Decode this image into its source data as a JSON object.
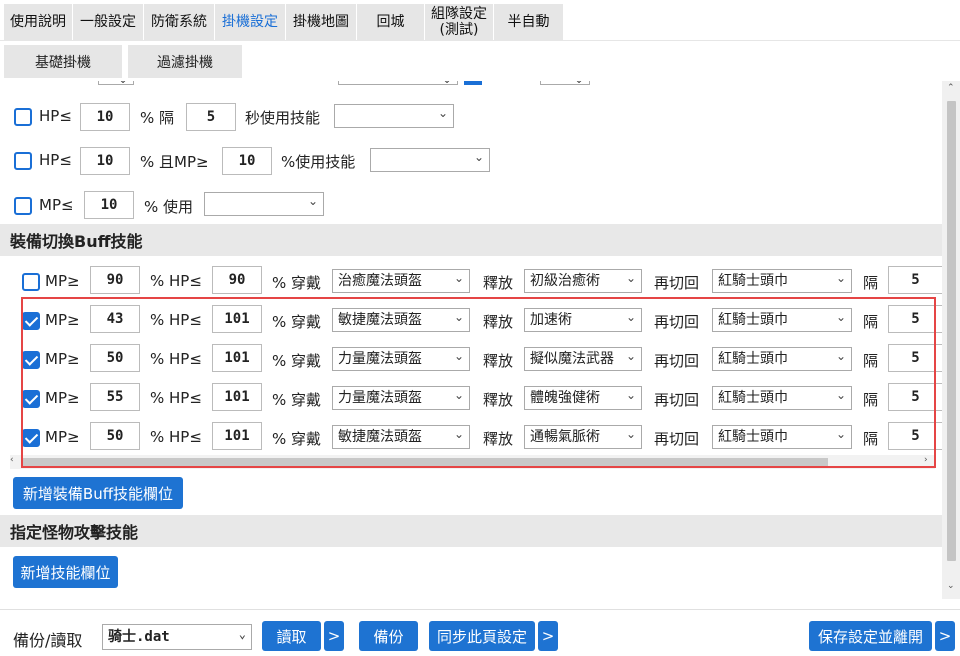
{
  "tabs": [
    {
      "label": "使用說明"
    },
    {
      "label": "一般設定"
    },
    {
      "label": "防衛系統"
    },
    {
      "label": "掛機設定"
    },
    {
      "label": "掛機地圖"
    },
    {
      "label": "回城"
    },
    {
      "label": "組隊設定\n(測試)"
    },
    {
      "label": "半自動"
    }
  ],
  "subtabs": [
    {
      "label": "基礎掛機"
    },
    {
      "label": "過濾掛機"
    }
  ],
  "hp_rows": [
    {
      "prefix": "HP≤",
      "value": "10",
      "mid": "% 隔",
      "value2": "5",
      "suffix": "秒使用技能",
      "select": ""
    },
    {
      "prefix": "HP≤",
      "value": "10",
      "mid": "% 且MP≥",
      "value2": "10",
      "suffix": "%使用技能",
      "select": ""
    },
    {
      "prefix": "MP≤",
      "value": "10",
      "mid": "% 使用",
      "select": ""
    }
  ],
  "buff_section": {
    "title": "裝備切換Buff技能"
  },
  "buff_labels": {
    "mp": "MP≥",
    "hp": "% HP≤",
    "wear": "% 穿戴",
    "release": "釋放",
    "switch_back": "再切回",
    "interval": "隔"
  },
  "buff_rows": [
    {
      "checked": false,
      "mp": "90",
      "hp": "90",
      "equip": "治癒魔法頭盔",
      "skill": "初級治癒術",
      "back": "紅騎士頭巾",
      "interval": "5"
    },
    {
      "checked": true,
      "mp": "43",
      "hp": "101",
      "equip": "敏捷魔法頭盔",
      "skill": "加速術",
      "back": "紅騎士頭巾",
      "interval": "5"
    },
    {
      "checked": true,
      "mp": "50",
      "hp": "101",
      "equip": "力量魔法頭盔",
      "skill": "擬似魔法武器",
      "back": "紅騎士頭巾",
      "interval": "5"
    },
    {
      "checked": true,
      "mp": "55",
      "hp": "101",
      "equip": "力量魔法頭盔",
      "skill": "體魄強健術",
      "back": "紅騎士頭巾",
      "interval": "5"
    },
    {
      "checked": true,
      "mp": "50",
      "hp": "101",
      "equip": "敏捷魔法頭盔",
      "skill": "通暢氣脈術",
      "back": "紅騎士頭巾",
      "interval": "5"
    }
  ],
  "add_buff_button": "新增裝備Buff技能欄位",
  "monster_section": {
    "title": "指定怪物攻擊技能"
  },
  "add_skill_button": "新增技能欄位",
  "bottom": {
    "backup_label": "備份/讀取",
    "file": "骑士.dat",
    "read": "讀取",
    "more": ">",
    "backup": "備份",
    "sync": "同步此頁設定",
    "save_exit": "保存設定並離開"
  },
  "colors": {
    "accent": "#1e73d2",
    "highlight": "#e54545"
  }
}
